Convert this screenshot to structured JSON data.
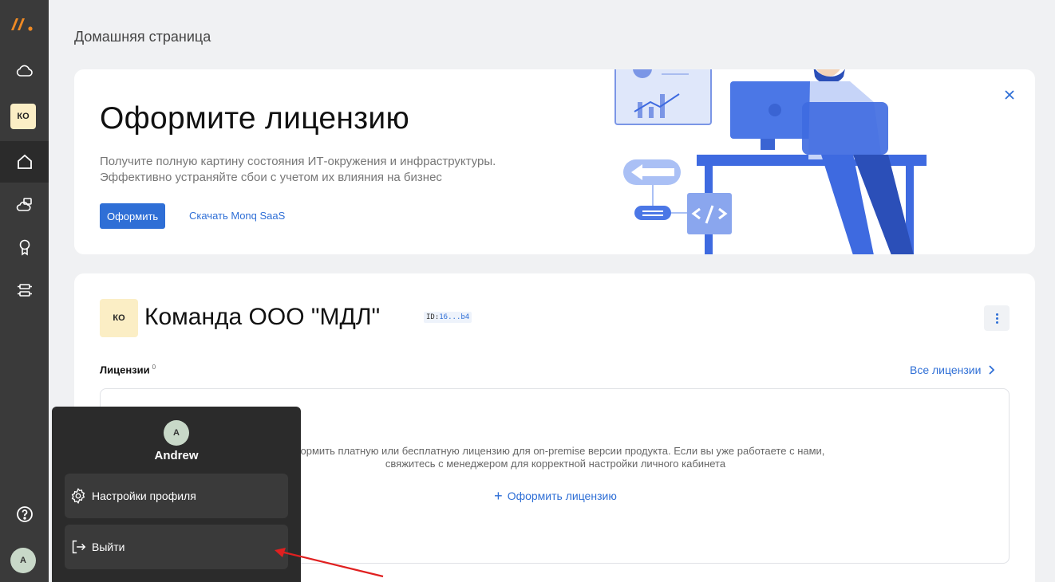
{
  "sidebar": {
    "team_badge": "КО",
    "avatar": "A"
  },
  "page": {
    "title": "Домашняя страница"
  },
  "banner": {
    "title": "Оформите лицензию",
    "subtitle_line1": "Получите полную картину состояния ИТ-окружения и инфраструктуры.",
    "subtitle_line2": "Эффективно устраняйте сбои с учетом их влияния на бизнес",
    "primary_button": "Оформить",
    "download_link": "Скачать Monq SaaS"
  },
  "team": {
    "badge": "КО",
    "name": "Команда ООО \"МДЛ\"",
    "id_label": "ID:",
    "id_value": "16...b4",
    "licenses_label": "Лицензии",
    "licenses_count": "0",
    "all_licenses": "Все лицензии",
    "empty_line1": "оформить платную или бесплатную лицензию для on-premise версии продукта. Если вы уже работаете с нами,",
    "empty_line2": "свяжитесь с менеджером для корректной настройки личного кабинета",
    "add_license": "Оформить лицензию"
  },
  "profile_menu": {
    "avatar": "A",
    "name": "Andrew",
    "settings": "Настройки профиля",
    "logout": "Выйти"
  },
  "colors": {
    "accent": "#2f6fd6",
    "sidebar": "#3a3a3a",
    "badge": "#fbeec5",
    "annotation_arrow": "#e02020"
  }
}
